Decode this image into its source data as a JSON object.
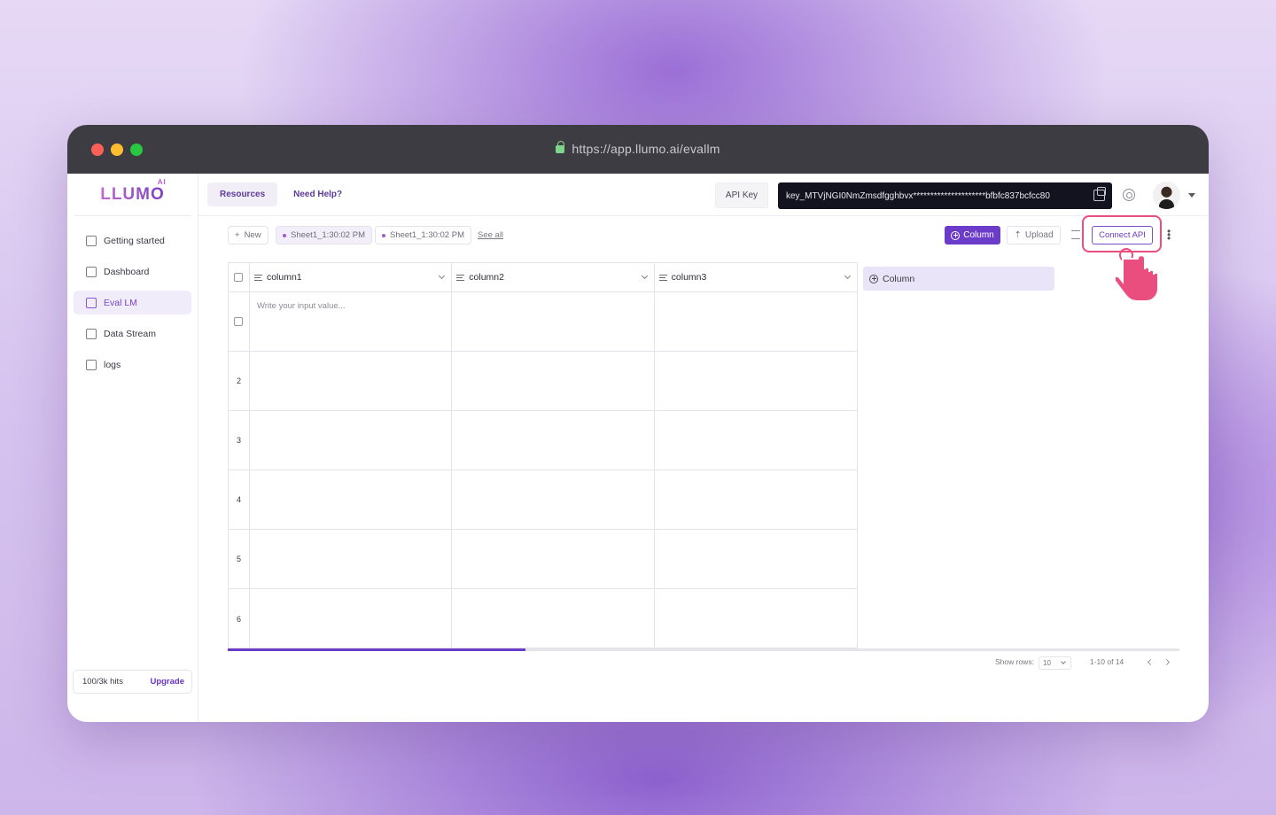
{
  "browser": {
    "url": "https://app.llumo.ai/evallm"
  },
  "logo": {
    "text": "LLUMO",
    "superscript": "AI"
  },
  "sidebar": {
    "items": [
      {
        "label": "Getting started",
        "icon": "rocket-icon"
      },
      {
        "label": "Dashboard",
        "icon": "dashboard-icon"
      },
      {
        "label": "Eval LM",
        "icon": "chart-icon",
        "active": true
      },
      {
        "label": "Data Stream",
        "icon": "data-stream-icon"
      },
      {
        "label": "logs",
        "icon": "logs-icon"
      }
    ],
    "hits": "100/3k hits",
    "upgrade": "Upgrade"
  },
  "header": {
    "resources": "Resources",
    "help": "Need Help?",
    "api_key_label": "API Key",
    "api_key_value": "key_MTVjNGI0NmZmsdfgghbvx*********************bfbfc837bcfcc80"
  },
  "toolbar": {
    "new": "New",
    "sheets": [
      "Sheet1_1:30:02 PM",
      "Sheet1_1:30:02 PM"
    ],
    "see_all": "See all",
    "column": "Column",
    "upload": "Upload",
    "connect_api": "Connect API"
  },
  "table": {
    "columns": [
      "column1",
      "column2",
      "column3"
    ],
    "placeholder": "Write your input value...",
    "row_numbers": [
      "2",
      "3",
      "4",
      "5",
      "6"
    ],
    "add_column": "Column"
  },
  "pagination": {
    "show_rows_label": "Show rows:",
    "rows_value": "10",
    "range": "1-10 of 14"
  },
  "colors": {
    "accent": "#6a3cc9",
    "highlight": "#e94e7e"
  }
}
